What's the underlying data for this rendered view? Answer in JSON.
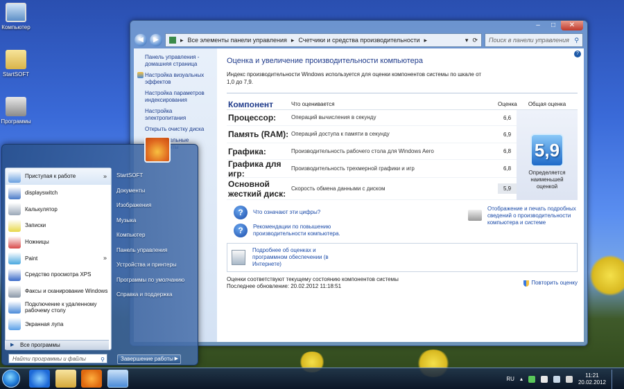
{
  "desktop": {
    "icons": [
      {
        "label": "Компьютер"
      },
      {
        "label": "StartSOFT"
      },
      {
        "label": "Программы"
      }
    ]
  },
  "window": {
    "breadcrumb": [
      "Все элементы панели управления",
      "Счетчики и средства производительности"
    ],
    "search_placeholder": "Поиск в панели управления",
    "sidebar": [
      {
        "label": "Панель управления - домашняя страница",
        "icon": false
      },
      {
        "label": "Настройка визуальных эффектов",
        "icon": true
      },
      {
        "label": "Настройка параметров индексирования",
        "icon": false
      },
      {
        "label": "Настройка электропитания",
        "icon": false
      },
      {
        "label": "Открыть очистку диска",
        "icon": false
      },
      {
        "label": "Дополнительные инструменты",
        "icon": false
      }
    ],
    "title": "Оценка и увеличение производительности компьютера",
    "intro": "Индекс производительности Windows используется для оценки компонентов системы по шкале от 1,0 до 7,9.",
    "table": {
      "headers": {
        "component": "Компонент",
        "what": "Что оценивается",
        "score": "Оценка",
        "base": "Общая оценка"
      },
      "rows": [
        {
          "component": "Процессор:",
          "what": "Операций вычисления в секунду",
          "score": "6,6"
        },
        {
          "component": "Память (RAM):",
          "what": "Операций доступа к памяти в секунду",
          "score": "6,9"
        },
        {
          "component": "Графика:",
          "what": "Производительность рабочего стола для Windows Aero",
          "score": "6,8"
        },
        {
          "component": "Графика для игр:",
          "what": "Производительность трехмерной графики и игр",
          "score": "6,8"
        },
        {
          "component": "Основной жесткий диск:",
          "what": "Скорость обмена данными с диском",
          "score": "5,9"
        }
      ],
      "base_score": "5,9",
      "base_caption": "Определяется наименьшей оценкой"
    },
    "links": {
      "what_numbers": "Что означают эти цифры?",
      "tips": "Рекомендации по повышению производительности компьютера.",
      "print": "Отображение и печать подробных сведений о производительности компьютера и системе",
      "more": "Подробнее об оценках и программном обеспечении (в Интернете)"
    },
    "footer": {
      "status": "Оценки соответствуют текущему состоянию компонентов системы",
      "last_update": "Последнее обновление: 20.02.2012 11:18:51",
      "rerun": "Повторить оценку"
    }
  },
  "start_menu": {
    "programs": [
      {
        "label": "Приступая к работе",
        "arrow": true,
        "color": "#6aa0e0"
      },
      {
        "label": "displayswitch",
        "arrow": false,
        "color": "#4a7ac8"
      },
      {
        "label": "Калькулятор",
        "arrow": false,
        "color": "#9aa8b8"
      },
      {
        "label": "Записки",
        "arrow": false,
        "color": "#e8d84a"
      },
      {
        "label": "Ножницы",
        "arrow": false,
        "color": "#d84a4a"
      },
      {
        "label": "Paint",
        "arrow": true,
        "color": "#4aa8e0"
      },
      {
        "label": "Средство просмотра XPS",
        "arrow": false,
        "color": "#3a6ac8"
      },
      {
        "label": "Факсы и сканирование Windows",
        "arrow": false,
        "color": "#8a98a8"
      },
      {
        "label": "Подключение к удаленному рабочему столу",
        "arrow": false,
        "color": "#4a8ad8"
      },
      {
        "label": "Экранная лупа",
        "arrow": false,
        "color": "#5aa0e8"
      }
    ],
    "all_programs": "Все программы",
    "search_placeholder": "Найти программы и файлы",
    "right_items": [
      "StartSOFT",
      "Документы",
      "Изображения",
      "Музыка",
      "Компьютер",
      "Панель управления",
      "Устройства и принтеры",
      "Программы по умолчанию",
      "Справка и поддержка"
    ],
    "shutdown": "Завершение работы"
  },
  "taskbar": {
    "lang": "RU",
    "time": "11:21",
    "date": "20.02.2012"
  }
}
